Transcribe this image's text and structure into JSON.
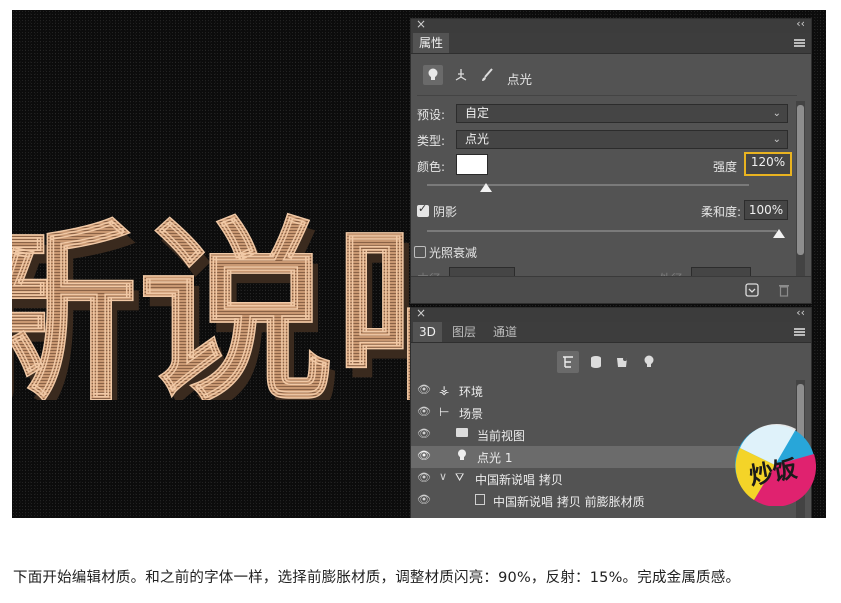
{
  "properties_panel": {
    "tab_label": "属性",
    "mode_title": "点光",
    "preset": {
      "label": "预设:",
      "value": "自定"
    },
    "type": {
      "label": "类型:",
      "value": "点光"
    },
    "color": {
      "label": "颜色:",
      "swatch": "#ffffff"
    },
    "intensity": {
      "label": "强度",
      "value": "120%"
    },
    "shadow": {
      "label": "阴影",
      "checked": true
    },
    "softness": {
      "label": "柔和度:",
      "value": "100%"
    },
    "falloff": {
      "label": "光照衰减",
      "checked": false
    },
    "inner_label": "内径:",
    "outer_label": "外径:"
  },
  "scene_panel": {
    "tabs": [
      "3D",
      "图层",
      "通道"
    ],
    "layers": [
      {
        "name": "环境",
        "icon": "environment-icon",
        "indent": 0,
        "selected": false
      },
      {
        "name": "场景",
        "icon": "scene-icon",
        "indent": 0,
        "selected": false
      },
      {
        "name": "当前视图",
        "icon": "camera-icon",
        "indent": 1,
        "selected": false
      },
      {
        "name": "点光 1",
        "icon": "lightbulb-icon",
        "indent": 1,
        "selected": true
      },
      {
        "name": "中国新说唱 拷贝",
        "icon": "mesh-icon",
        "indent": 0,
        "selected": false
      },
      {
        "name": "中国新说唱 拷贝 前膨胀材质",
        "icon": "material-icon",
        "indent": 2,
        "selected": false
      }
    ]
  },
  "artwork_text": "新说唱",
  "badge_text": "炒饭",
  "caption": "下面开始编辑材质。和之前的字体一样，选择前膨胀材质，调整材质闪亮：90%，反射：15%。完成金属质感。",
  "colors": {
    "panel_bg": "#535353",
    "highlight": "#e9b320",
    "text_art": "#d3a27c"
  }
}
